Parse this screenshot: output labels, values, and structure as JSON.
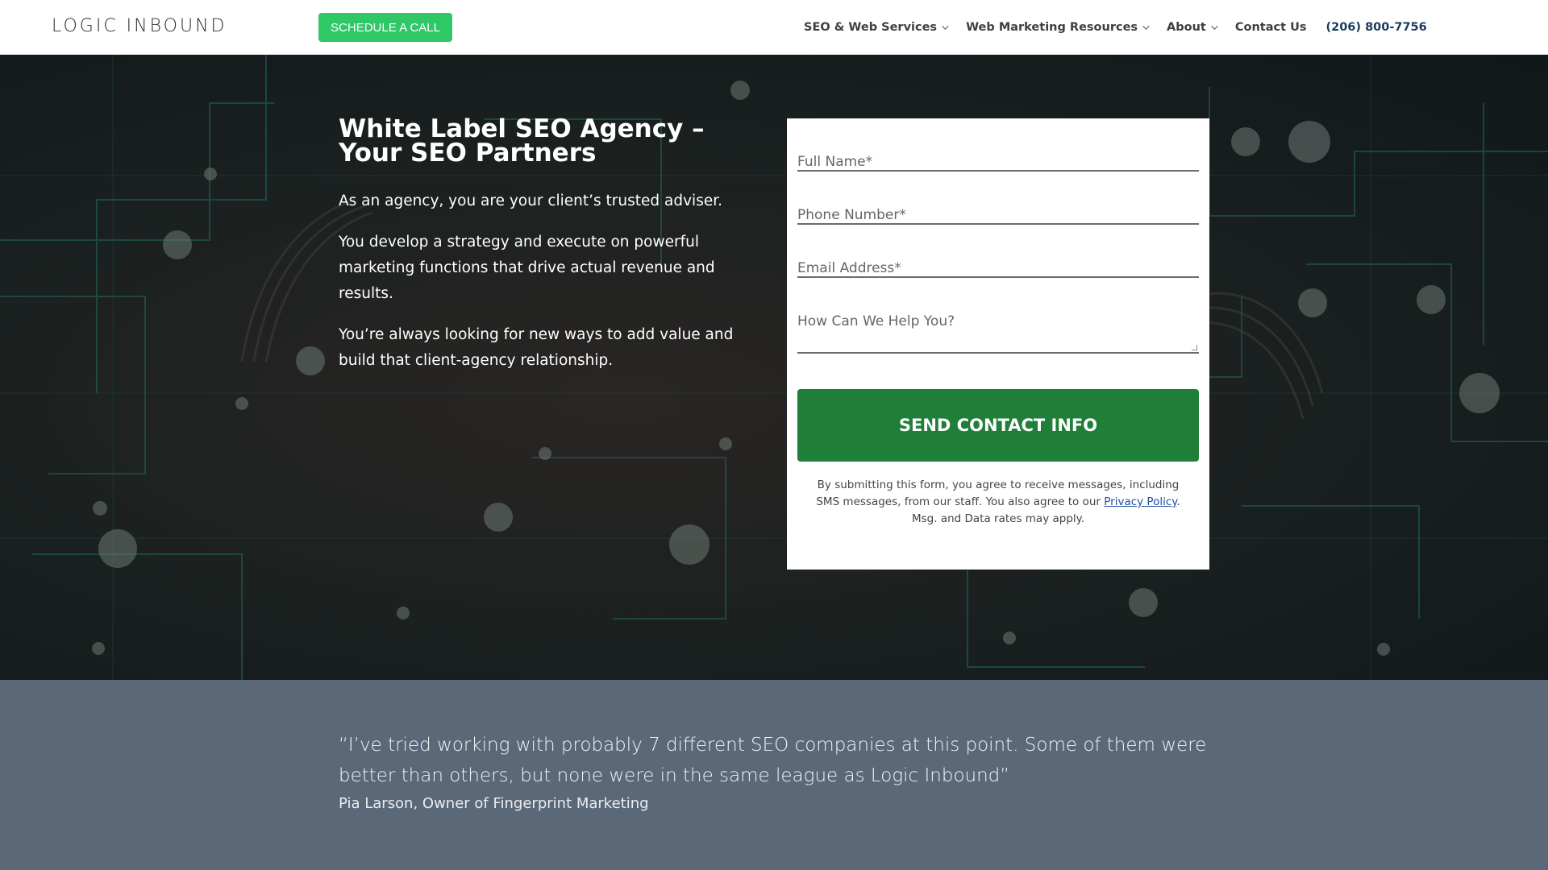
{
  "header": {
    "logo": "LOGIC INBOUND",
    "schedule_button": "SCHEDULE A CALL",
    "nav": [
      {
        "label": "SEO & Web Services",
        "has_dropdown": true
      },
      {
        "label": "Web Marketing Resources",
        "has_dropdown": true
      },
      {
        "label": "About",
        "has_dropdown": true
      },
      {
        "label": "Contact Us",
        "has_dropdown": false
      }
    ],
    "phone": "(206) 800-7756"
  },
  "hero": {
    "title": "White Label SEO Agency – Your SEO Partners",
    "paragraphs": [
      "As an agency, you are your client’s trusted adviser.",
      "You develop a strategy and execute on powerful marketing functions that drive actual revenue and results.",
      "You’re always looking for new ways to add value and build that client-agency relationship."
    ]
  },
  "form": {
    "full_name_placeholder": "Full Name*",
    "phone_placeholder": "Phone Number*",
    "email_placeholder": "Email Address*",
    "message_placeholder": "How Can We Help You?",
    "submit_label": "SEND CONTACT INFO",
    "disclaimer_before": "By submitting this form, you agree to receive messages, including SMS messages, from our staff. You also agree to our ",
    "privacy_link": "Privacy Policy",
    "disclaimer_after": ". Msg. and Data rates may apply."
  },
  "testimonial": {
    "quote": "“I’ve tried working with probably 7 different SEO companies at this point. Some of them were better than others, but none were in the same league as Logic Inbound”",
    "author": "Pia Larson, Owner of Fingerprint Marketing"
  },
  "colors": {
    "accent_green": "#2ec866",
    "button_green": "#1f7e37",
    "testimonial_bg": "#5b6878",
    "phone_color": "#1a3a5c"
  }
}
